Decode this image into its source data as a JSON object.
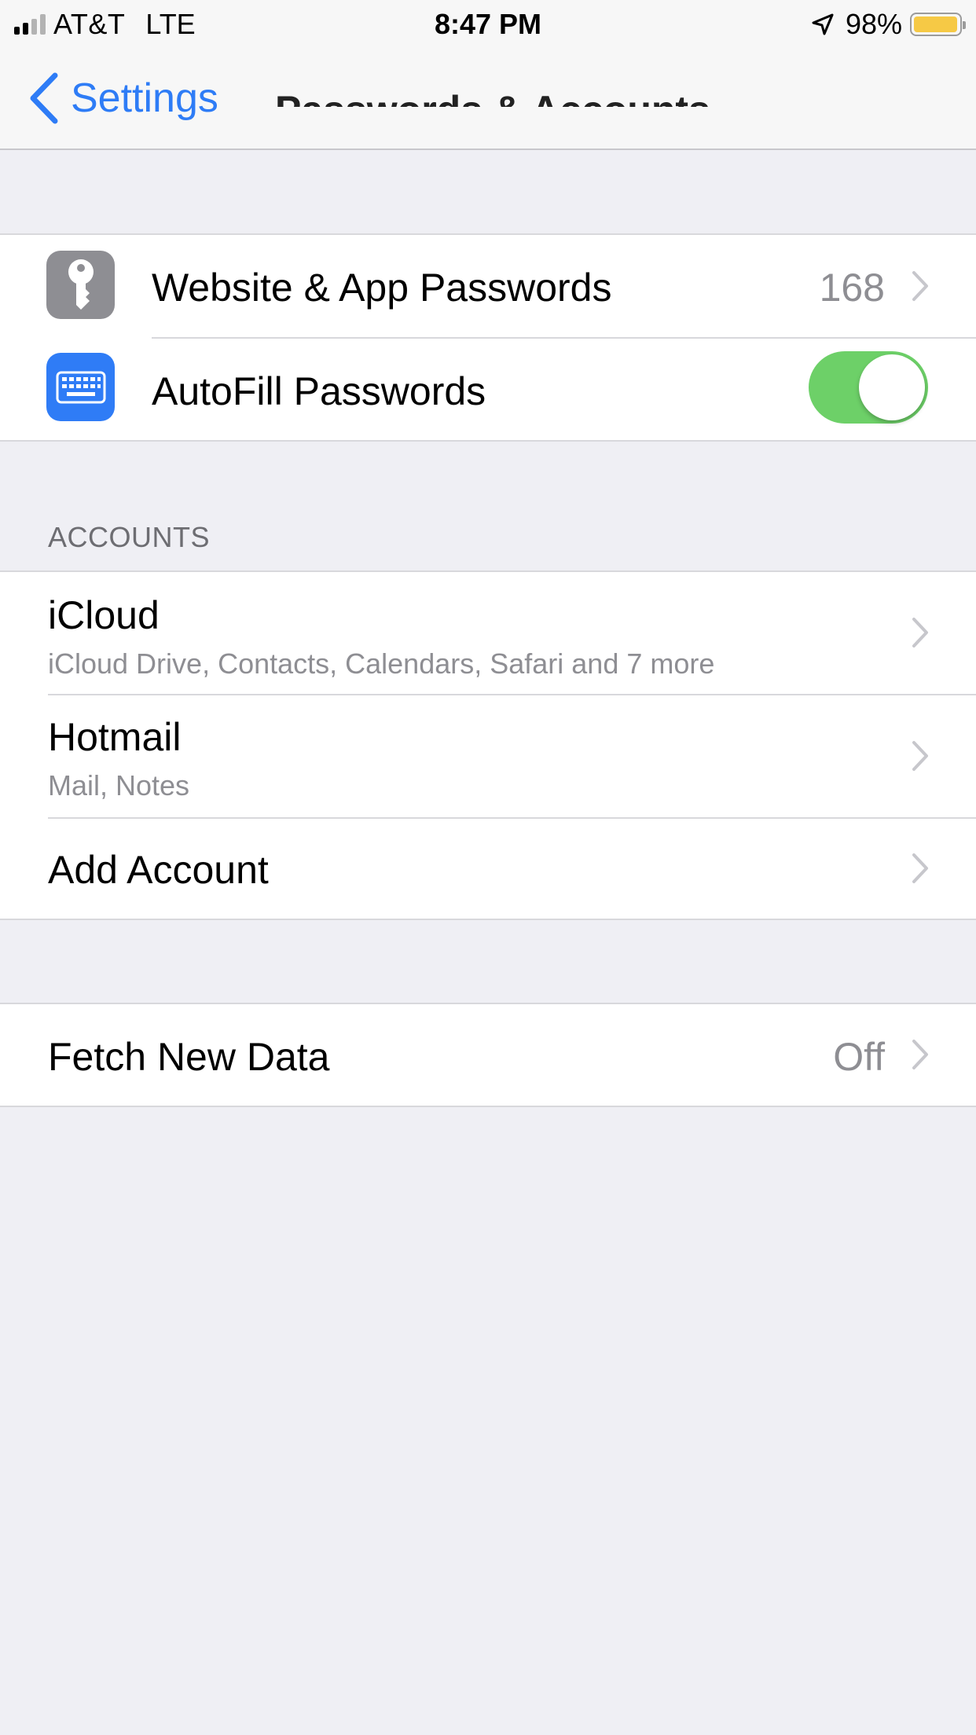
{
  "status_bar": {
    "carrier": "AT&T",
    "network": "LTE",
    "time": "8:47 PM",
    "battery_percent": "98%",
    "battery_level": 0.98,
    "icons": [
      "signal-icon",
      "location-arrow-icon",
      "battery-icon"
    ]
  },
  "nav": {
    "back_label": "Settings",
    "title": "Passwords & Accounts"
  },
  "passwords": {
    "website_app": {
      "label": "Website & App Passwords",
      "count": "168",
      "icon": "key-icon",
      "icon_color": "#8e8e93"
    },
    "autofill": {
      "label": "AutoFill Passwords",
      "enabled": true,
      "icon": "keyboard-icon",
      "icon_color": "#2f7cf6"
    }
  },
  "accounts": {
    "header": "ACCOUNTS",
    "items": [
      {
        "name": "iCloud",
        "detail": "iCloud Drive, Contacts, Calendars, Safari and 7 more"
      },
      {
        "name": "Hotmail",
        "detail": "Mail, Notes"
      }
    ],
    "add_label": "Add Account"
  },
  "fetch": {
    "label": "Fetch New Data",
    "value": "Off"
  },
  "colors": {
    "accent": "#2e7cf6",
    "toggle_on": "#6dd068",
    "background": "#efeff4"
  }
}
